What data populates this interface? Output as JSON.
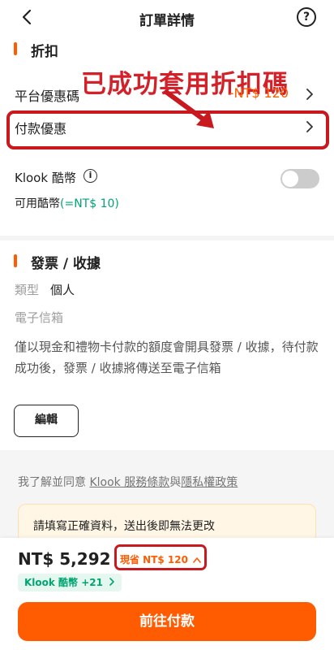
{
  "header": {
    "title": "訂單詳情",
    "help": "?"
  },
  "discount": {
    "section_title": "折扣",
    "annotation": "已成功套用折扣碼",
    "promo_label": "平台優惠碼",
    "promo_value": "-NT$ 120",
    "payment_label": "付款優惠",
    "klook_credits_label": "Klook 酷幣",
    "info": "i",
    "available_label": "可用酷幣",
    "available_value": "(=NT$ 10)",
    "credits_toggle_on": false
  },
  "invoice": {
    "section_title": "發票 / 收據",
    "type_label": "類型",
    "type_value": "個人",
    "email_label": "電子信箱",
    "note": "僅以現金和禮物卡付款的額度會開具發票 / 收據，待付款成功後，發票 / 收據將傳送至電子信箱",
    "edit_label": "編輯"
  },
  "agreement": {
    "prefix": "我了解並同意 ",
    "terms": "Klook 服務條款",
    "and": "與",
    "privacy": "隱私權政策"
  },
  "warning": {
    "text": "請填寫正確資料，送出後即無法更改"
  },
  "bottom_bar": {
    "price": "NT$ 5,292",
    "save": "現省 NT$ 120",
    "credits": "Klook 酷幣 +21",
    "pay_label": "前往付款"
  },
  "colors": {
    "accent": "#ff5b00",
    "annotation_red": "#c8191f",
    "green": "#00a672"
  }
}
